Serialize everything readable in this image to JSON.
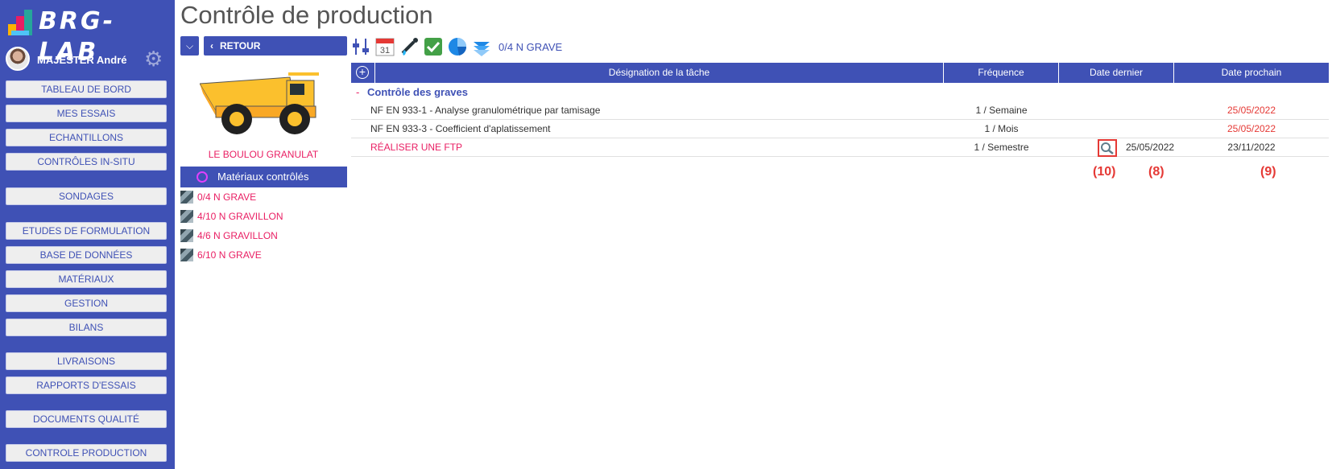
{
  "app": {
    "logo_text": "BRG-LAB",
    "user_name": "MAJESTER André"
  },
  "sidebar": {
    "items": [
      {
        "label": "TABLEAU DE BORD"
      },
      {
        "label": "MES ESSAIS"
      },
      {
        "label": "ECHANTILLONS"
      },
      {
        "label": "CONTRÔLES IN-SITU"
      },
      {
        "label": "SONDAGES"
      },
      {
        "label": "ETUDES DE FORMULATION"
      },
      {
        "label": "BASE DE DONNÉES"
      },
      {
        "label": "MATÉRIAUX"
      },
      {
        "label": "GESTION"
      },
      {
        "label": "BILANS"
      },
      {
        "label": "LIVRAISONS"
      },
      {
        "label": "RAPPORTS D'ESSAIS"
      },
      {
        "label": "DOCUMENTS QUALITÉ"
      },
      {
        "label": "CONTROLE PRODUCTION"
      }
    ]
  },
  "page": {
    "title": "Contrôle de production",
    "back_label": "RETOUR"
  },
  "left_panel": {
    "site_name": "LE BOULOU GRANULAT",
    "materials_header": "Matériaux contrôlés",
    "materials": [
      {
        "label": "0/4 N GRAVE"
      },
      {
        "label": "4/10 N GRAVILLON"
      },
      {
        "label": "4/6 N GRAVILLON"
      },
      {
        "label": "6/10 N GRAVE"
      }
    ]
  },
  "toolbar": {
    "icons": [
      "sliders-icon",
      "calendar-icon",
      "pipette-icon",
      "check-icon",
      "pie-chart-icon",
      "layers-icon"
    ],
    "calendar_day": "31",
    "current_material": "0/4 N GRAVE"
  },
  "table": {
    "headers": {
      "designation": "Désignation de la tâche",
      "frequency": "Fréquence",
      "last_date": "Date dernier",
      "next_date": "Date prochain"
    },
    "group": {
      "label": "Contrôle des graves",
      "toggle": "-"
    },
    "rows": [
      {
        "designation": "NF EN 933-1 - Analyse granulométrique par tamisage",
        "frequency": "1 / Semaine",
        "last_date": "",
        "next_date": "25/05/2022"
      },
      {
        "designation": "NF EN 933-3 - Coefficient d'aplatissement",
        "frequency": "1 / Mois",
        "last_date": "",
        "next_date": "25/05/2022"
      },
      {
        "designation": "RÉALISER UNE FTP",
        "frequency": "1 / Semestre",
        "last_date": "25/05/2022",
        "next_date": "23/11/2022"
      }
    ]
  },
  "annotations": {
    "a10": "(10)",
    "a8": "(8)",
    "a9": "(9)"
  },
  "colors": {
    "primary": "#3f51b5",
    "accent_pink": "#e91e63",
    "alert_red": "#e53935"
  }
}
